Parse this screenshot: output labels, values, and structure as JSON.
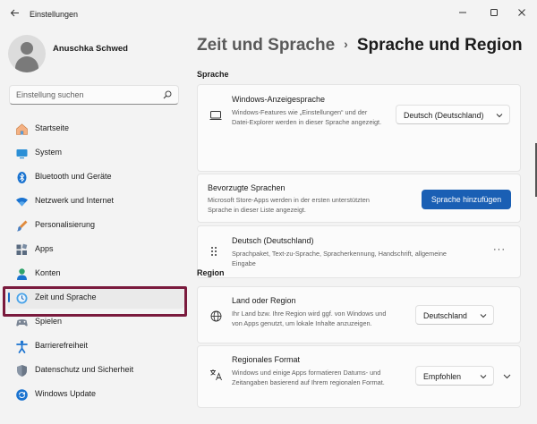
{
  "app": {
    "title": "Einstellungen",
    "back_icon": "arrow-left-icon",
    "controls": [
      "minimize-icon",
      "maximize-icon",
      "close-icon"
    ]
  },
  "user": {
    "name": "Anuschka Schwed"
  },
  "search": {
    "placeholder": "Einstellung suchen",
    "icon": "search-icon"
  },
  "sidebar": {
    "items": [
      {
        "label": "Startseite",
        "icon": "home-icon"
      },
      {
        "label": "System",
        "icon": "system-icon"
      },
      {
        "label": "Bluetooth und Geräte",
        "icon": "bluetooth-icon"
      },
      {
        "label": "Netzwerk und Internet",
        "icon": "wifi-icon"
      },
      {
        "label": "Personalisierung",
        "icon": "brush-icon"
      },
      {
        "label": "Apps",
        "icon": "apps-icon"
      },
      {
        "label": "Konten",
        "icon": "account-icon"
      },
      {
        "label": "Zeit und Sprache",
        "icon": "time-language-icon",
        "active": true
      },
      {
        "label": "Spielen",
        "icon": "gaming-icon"
      },
      {
        "label": "Barrierefreiheit",
        "icon": "accessibility-icon"
      },
      {
        "label": "Datenschutz und Sicherheit",
        "icon": "shield-icon"
      },
      {
        "label": "Windows Update",
        "icon": "update-icon"
      }
    ]
  },
  "breadcrumb": {
    "parent": "Zeit und Sprache",
    "separator": "›",
    "current": "Sprache und Region"
  },
  "language_section": {
    "title": "Sprache",
    "display_language": {
      "title": "Windows-Anzeigesprache",
      "description": "Windows-Features wie „Einstellungen“ und der Datei-Explorer werden in dieser Sprache angezeigt.",
      "value": "Deutsch (Deutschland)"
    },
    "preferred": {
      "title": "Bevorzugte Sprachen",
      "description": "Microsoft Store-Apps werden in der ersten unterstützten Sprache in dieser Liste angezeigt.",
      "button": "Sprache hinzufügen"
    },
    "language_item": {
      "title": "Deutsch (Deutschland)",
      "description": "Sprachpaket, Text-zu-Sprache, Spracherkennung, Handschrift, allgemeine Eingabe",
      "more": "···"
    }
  },
  "region_section": {
    "title": "Region",
    "country": {
      "title": "Land oder Region",
      "description": "Ihr Land bzw. Ihre Region wird ggf. von Windows und von Apps genutzt, um lokale Inhalte anzuzeigen.",
      "value": "Deutschland"
    },
    "format": {
      "title": "Regionales Format",
      "description": "Windows und einige Apps formatieren Datums- und Zeitangaben basierend auf Ihrem regionalen Format.",
      "value": "Empfohlen"
    }
  },
  "colors": {
    "accent": "#1a5fb4",
    "highlight_border": "#7a1a3d"
  }
}
